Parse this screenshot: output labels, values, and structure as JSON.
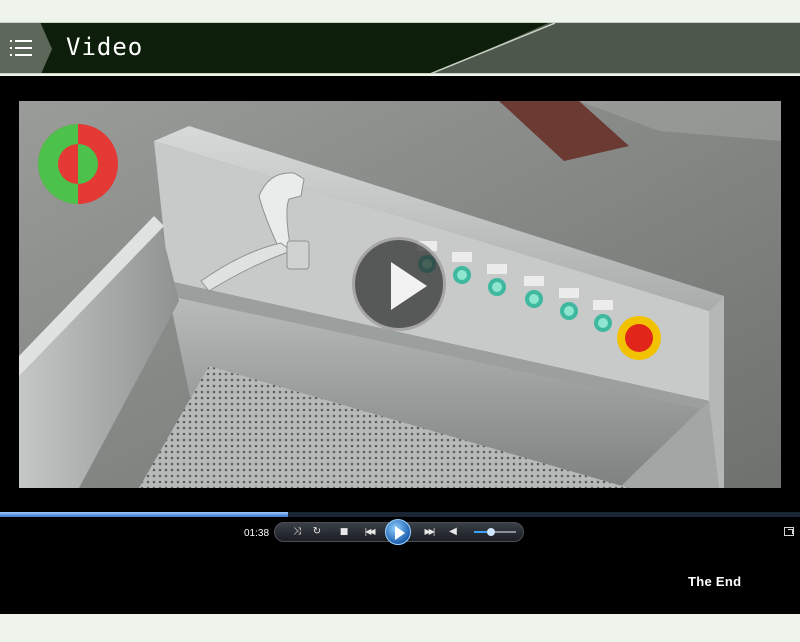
{
  "header": {
    "title": "Video",
    "menu_icon": "list-menu-icon"
  },
  "player": {
    "current_time": "01:38",
    "progress": 0.36,
    "volume": 0.4,
    "end_label": "The End",
    "controls": [
      "shuffle-icon",
      "repeat-icon",
      "stop-icon",
      "previous-icon",
      "play-icon",
      "next-icon",
      "volume-icon",
      "fullscreen-icon"
    ]
  },
  "colors": {
    "header_bg": "#0d1f0a",
    "page_bg": "#eef3ec",
    "progress_blue": "#3c78c8",
    "logo_red": "#e53935",
    "logo_green": "#4cc14b"
  }
}
